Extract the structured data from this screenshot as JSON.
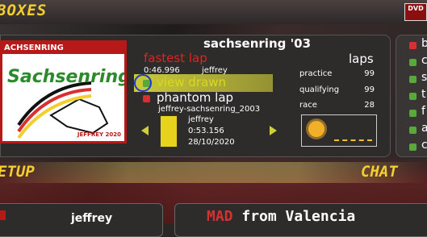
{
  "header": {
    "title": "BOXES",
    "badge": "DVD"
  },
  "track_card": {
    "top_text": "ACHSENRING",
    "logo_text": "Sachsenring",
    "bottom_text": "JEFFREY 2020"
  },
  "track": {
    "name": "sachsenring '03"
  },
  "fastest_lap": {
    "label": "fastest lap",
    "time": "0:46.996",
    "driver": "jeffrey"
  },
  "options": {
    "view_drawn": {
      "label": "view drawn",
      "dot_color": "#5aa73b"
    },
    "phantom_lap": {
      "label": "phantom lap",
      "dot_color": "#d63030"
    }
  },
  "phantom": {
    "file": "jeffrey-sachsenring_2003",
    "driver": "jeffrey",
    "time": "0:53.156",
    "date": "28/10/2020"
  },
  "laps": {
    "label": "laps",
    "rows": [
      {
        "label": "practice",
        "value": "99"
      },
      {
        "label": "qualifying",
        "value": "99"
      },
      {
        "label": "race",
        "value": "28"
      }
    ]
  },
  "weather": {
    "icon": "sun-icon"
  },
  "sidebar": {
    "items": [
      {
        "char": "b",
        "dot_color": "#d63030"
      },
      {
        "char": "c",
        "dot_color": "#5aa73b"
      },
      {
        "char": "s",
        "dot_color": "#5aa73b"
      },
      {
        "char": "t",
        "dot_color": "#5aa73b"
      },
      {
        "char": "f",
        "dot_color": "#5aa73b"
      },
      {
        "char": "a",
        "dot_color": "#5aa73b"
      },
      {
        "char": "c",
        "dot_color": "#5aa73b"
      }
    ]
  },
  "sections": {
    "setup": "ETUP",
    "chat": "CHAT"
  },
  "bottom": {
    "driver": "jeffrey",
    "chat_tag": "MAD",
    "chat_text": "from Valencia"
  }
}
